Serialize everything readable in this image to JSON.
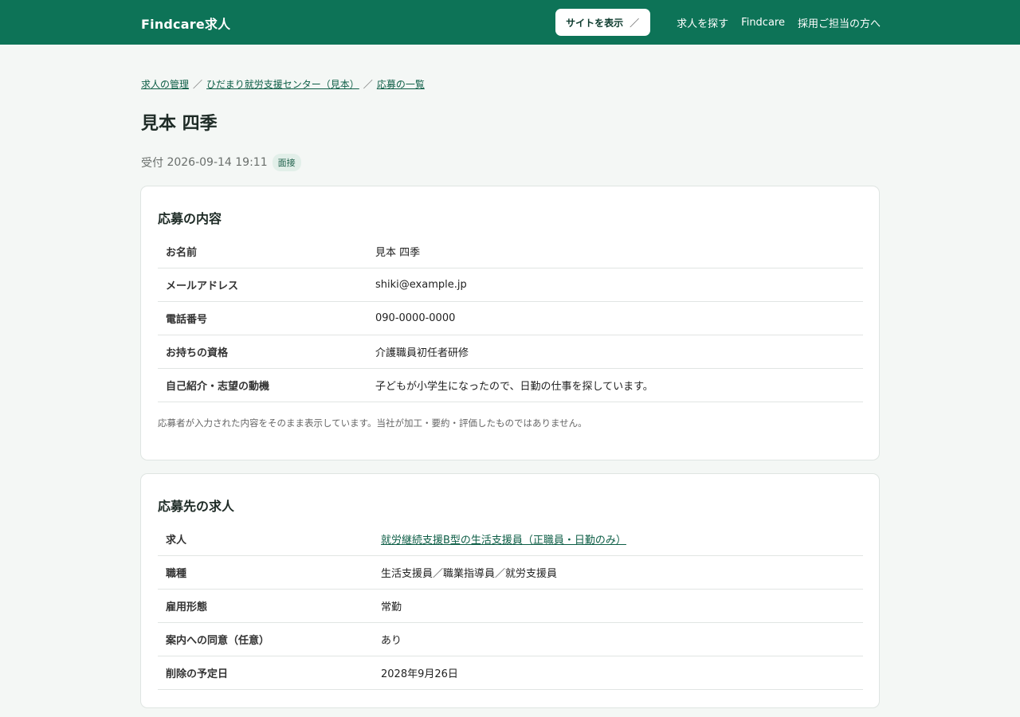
{
  "header": {
    "brand": "Findcare求人",
    "site_button_label": "サイトを表示",
    "site_button_icon": "／",
    "nav": [
      "求人を探す",
      "Findcare",
      "採用ご担当の方へ"
    ],
    "bg_color": "#0d7357"
  },
  "breadcrumb": {
    "items": [
      "求人の管理",
      "ひだまり就労支援センター（見本）",
      "応募の一覧"
    ],
    "separator": "／"
  },
  "applicant": {
    "name": "見本 四季",
    "received_label": "受付",
    "received_at": "2026-09-14 19:11",
    "status": "面接"
  },
  "application": {
    "title": "応募の内容",
    "rows": [
      {
        "label": "お名前",
        "value": "見本 四季"
      },
      {
        "label": "メールアドレス",
        "value": "shiki@example.jp"
      },
      {
        "label": "電話番号",
        "value": "090-0000-0000"
      },
      {
        "label": "お持ちの資格",
        "value": "介護職員初任者研修"
      },
      {
        "label": "自己紹介・志望の動機",
        "value": "子どもが小学生になったので、日勤の仕事を探しています。"
      }
    ],
    "note": "応募者が入力された内容をそのまま表示しています。当社が加工・要約・評価したものではありません。"
  },
  "job": {
    "title": "応募先の求人",
    "rows": [
      {
        "label": "求人",
        "value": "就労継続支援B型の生活支援員（正職員・日勤のみ）",
        "link": true
      },
      {
        "label": "職種",
        "value": "生活支援員／職業指導員／就労支援員"
      },
      {
        "label": "雇用形態",
        "value": "常勤"
      },
      {
        "label": "案内への同意（任意）",
        "value": "あり"
      },
      {
        "label": "削除の予定日",
        "value": "2028年9月26日"
      }
    ]
  }
}
